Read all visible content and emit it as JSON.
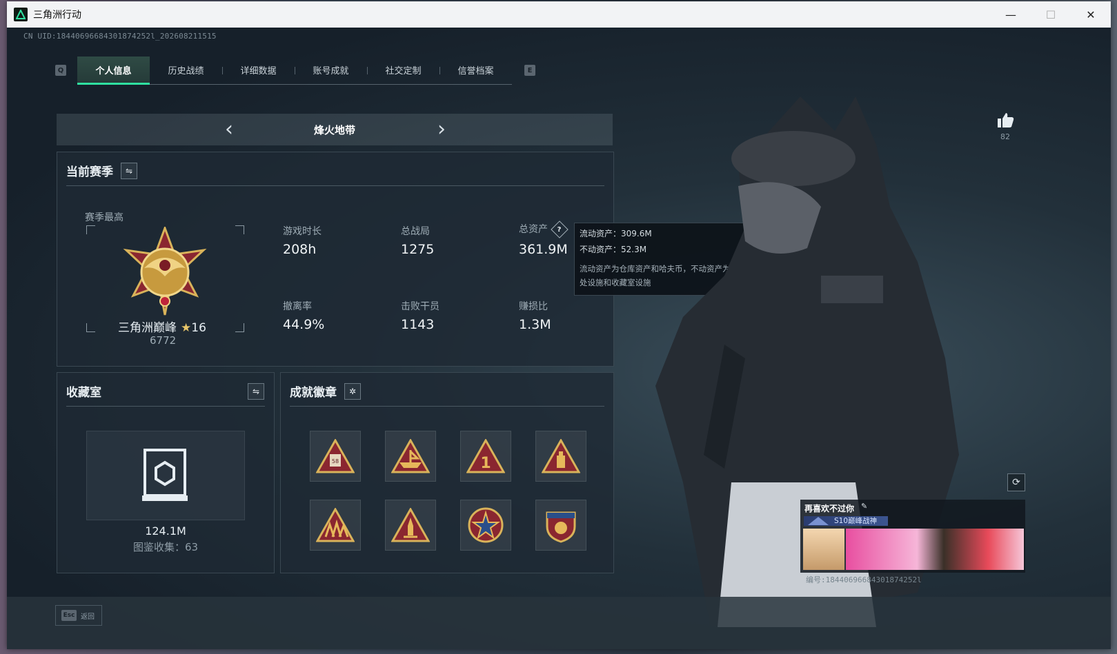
{
  "window": {
    "title": "三角洲行动",
    "minimize": "—",
    "maximize": "☐",
    "close": "✕"
  },
  "uid_text": "CN UID:18440696684301874252l_202608211515",
  "tabs": {
    "left_key": "Q",
    "right_key": "E",
    "items": [
      {
        "label": "个人信息",
        "active": true
      },
      {
        "label": "历史战绩"
      },
      {
        "label": "详细数据"
      },
      {
        "label": "账号成就"
      },
      {
        "label": "社交定制"
      },
      {
        "label": "信誉档案"
      }
    ]
  },
  "mode": {
    "title": "烽火地带",
    "prev": "‹",
    "next": "›"
  },
  "season": {
    "title": "当前赛季",
    "swap_icon": "⇋",
    "best_label": "赛季最高",
    "rank_name": "三角洲巅峰",
    "rank_star_icon": "★",
    "rank_level": "16",
    "rank_points": "6772",
    "stats": [
      {
        "label": "游戏时长",
        "value": "208h"
      },
      {
        "label": "总战局",
        "value": "1275"
      },
      {
        "label": "总资产",
        "value": "361.9M",
        "help": "?"
      },
      {
        "label": "撤离率",
        "value": "44.9%"
      },
      {
        "label": "击败干员",
        "value": "1143"
      },
      {
        "label": "赚损比",
        "value": "1.3M"
      }
    ]
  },
  "tooltip": {
    "liquid": "流动资产：309.6M",
    "fixed": "不动资产：52.3M",
    "note": "流动资产为仓库资产和哈夫币，不动资产为特勤处设施和收藏室设施"
  },
  "collection": {
    "title": "收藏室",
    "swap_icon": "⇋",
    "value": "124.1M",
    "count": "图鉴收集：63"
  },
  "badges": {
    "title": "成就徽章",
    "settings_icon": "✲",
    "items": [
      "badge-58-icon",
      "badge-boat-icon",
      "badge-number-one-icon",
      "badge-bottle-icon",
      "badge-soldiers-icon",
      "badge-rocket-icon",
      "badge-star-emblem-icon",
      "badge-shield-emblem-icon"
    ]
  },
  "like": {
    "count": "82"
  },
  "player_card": {
    "name": "再喜欢不过你",
    "title": "S10巅峰战神",
    "uid": "编号:18440696684301874252l"
  },
  "footer": {
    "esc_key": "Esc",
    "esc_label": "返回"
  },
  "colors": {
    "accent": "#2fe0a0",
    "background": "#1a232b"
  }
}
